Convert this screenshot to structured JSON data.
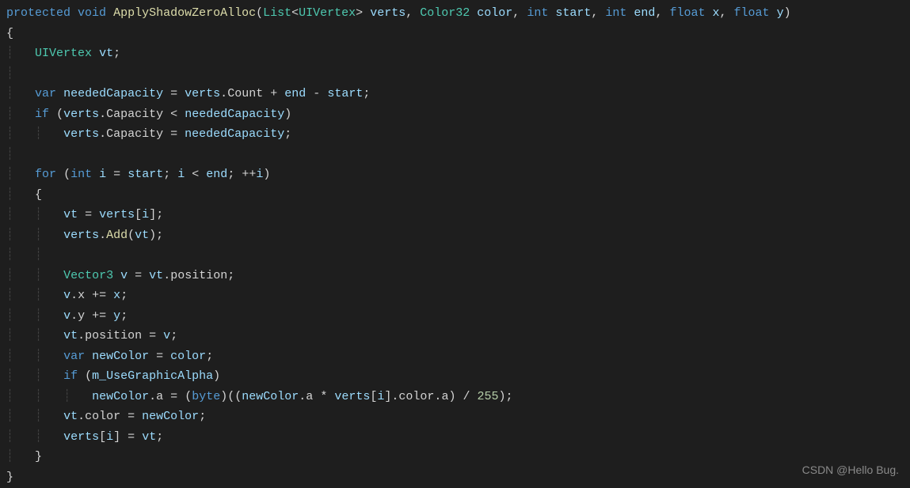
{
  "code": {
    "line1_protected": "protected",
    "line1_void": "void",
    "line1_method": "ApplyShadowZeroAlloc",
    "line1_list": "List",
    "line1_uivertex": "UIVertex",
    "line1_verts": "verts",
    "line1_color32": "Color32",
    "line1_color": "color",
    "line1_int1": "int",
    "line1_start": "start",
    "line1_int2": "int",
    "line1_end": "end",
    "line1_float1": "float",
    "line1_x": "x",
    "line1_float2": "float",
    "line1_y": "y",
    "line2_brace": "{",
    "line3_uivertex": "UIVertex",
    "line3_vt": "vt",
    "line5_var": "var",
    "line5_neededCapacity": "neededCapacity",
    "line5_verts": "verts",
    "line5_count": "Count",
    "line5_end": "end",
    "line5_start": "start",
    "line6_if": "if",
    "line6_verts": "verts",
    "line6_capacity": "Capacity",
    "line6_neededCapacity": "neededCapacity",
    "line7_verts": "verts",
    "line7_capacity": "Capacity",
    "line7_neededCapacity": "neededCapacity",
    "line9_for": "for",
    "line9_int": "int",
    "line9_i": "i",
    "line9_start": "start",
    "line9_i2": "i",
    "line9_end": "end",
    "line9_i3": "i",
    "line10_brace": "{",
    "line11_vt": "vt",
    "line11_verts": "verts",
    "line11_i": "i",
    "line12_verts": "verts",
    "line12_add": "Add",
    "line12_vt": "vt",
    "line14_vector3": "Vector3",
    "line14_v": "v",
    "line14_vt": "vt",
    "line14_position": "position",
    "line15_v": "v",
    "line15_x": "x",
    "line15_x2": "x",
    "line16_v": "v",
    "line16_y": "y",
    "line16_y2": "y",
    "line17_vt": "vt",
    "line17_position": "position",
    "line17_v": "v",
    "line18_var": "var",
    "line18_newColor": "newColor",
    "line18_color": "color",
    "line19_if": "if",
    "line19_mUseGraphicAlpha": "m_UseGraphicAlpha",
    "line20_newColor": "newColor",
    "line20_a": "a",
    "line20_byte": "byte",
    "line20_newColor2": "newColor",
    "line20_a2": "a",
    "line20_verts": "verts",
    "line20_i": "i",
    "line20_color": "color",
    "line20_a3": "a",
    "line20_255": "255",
    "line21_vt": "vt",
    "line21_color": "color",
    "line21_newColor": "newColor",
    "line22_verts": "verts",
    "line22_i": "i",
    "line22_vt": "vt",
    "line23_brace": "}",
    "line24_brace": "}"
  },
  "watermark": "CSDN @Hello Bug."
}
